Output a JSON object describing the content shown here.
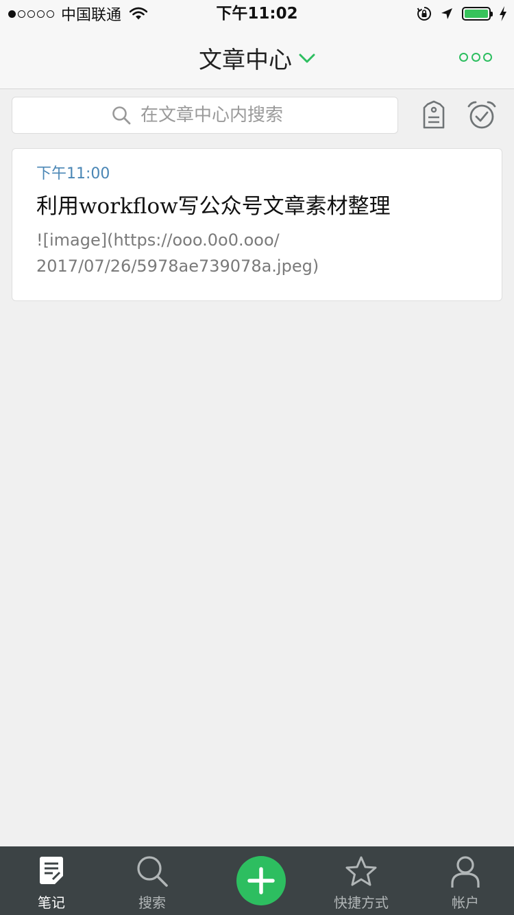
{
  "status_bar": {
    "signal_strength": 1,
    "signal_total": 5,
    "carrier": "中国联通",
    "time": "下午11:02",
    "battery_level": 1.0,
    "battery_color": "#37c35b",
    "icons": [
      "wifi-icon",
      "orientation-lock-icon",
      "location-arrow-icon",
      "battery-icon",
      "charging-bolt-icon"
    ]
  },
  "header": {
    "title": "文章中心",
    "dropdown_icon": "chevron-down-icon",
    "more_icon": "more-dots-icon",
    "accent_color": "#2dbe60"
  },
  "search": {
    "placeholder": "在文章中心内搜索",
    "value": "",
    "icon": "search-icon"
  },
  "toolbar_icons": [
    "tag-icon",
    "reminder-alarm-icon"
  ],
  "notes": [
    {
      "time": "下午11:00",
      "title": "利用workflow写公众号文章素材整理",
      "snippet_line1": "![image](https://ooo.0o0.ooo/",
      "snippet_line2": "2017/07/26/5978ae739078a.jpeg)"
    }
  ],
  "tab_bar": {
    "tabs": [
      {
        "label": "笔记",
        "icon": "notes-icon",
        "active": true
      },
      {
        "label": "搜索",
        "icon": "search-icon",
        "active": false
      },
      {
        "label": "",
        "icon": "plus-icon",
        "active": false
      },
      {
        "label": "快捷方式",
        "icon": "star-icon",
        "active": false
      },
      {
        "label": "帐户",
        "icon": "account-icon",
        "active": false
      }
    ],
    "background": "#3c4345",
    "add_button_color": "#2dbe60"
  }
}
